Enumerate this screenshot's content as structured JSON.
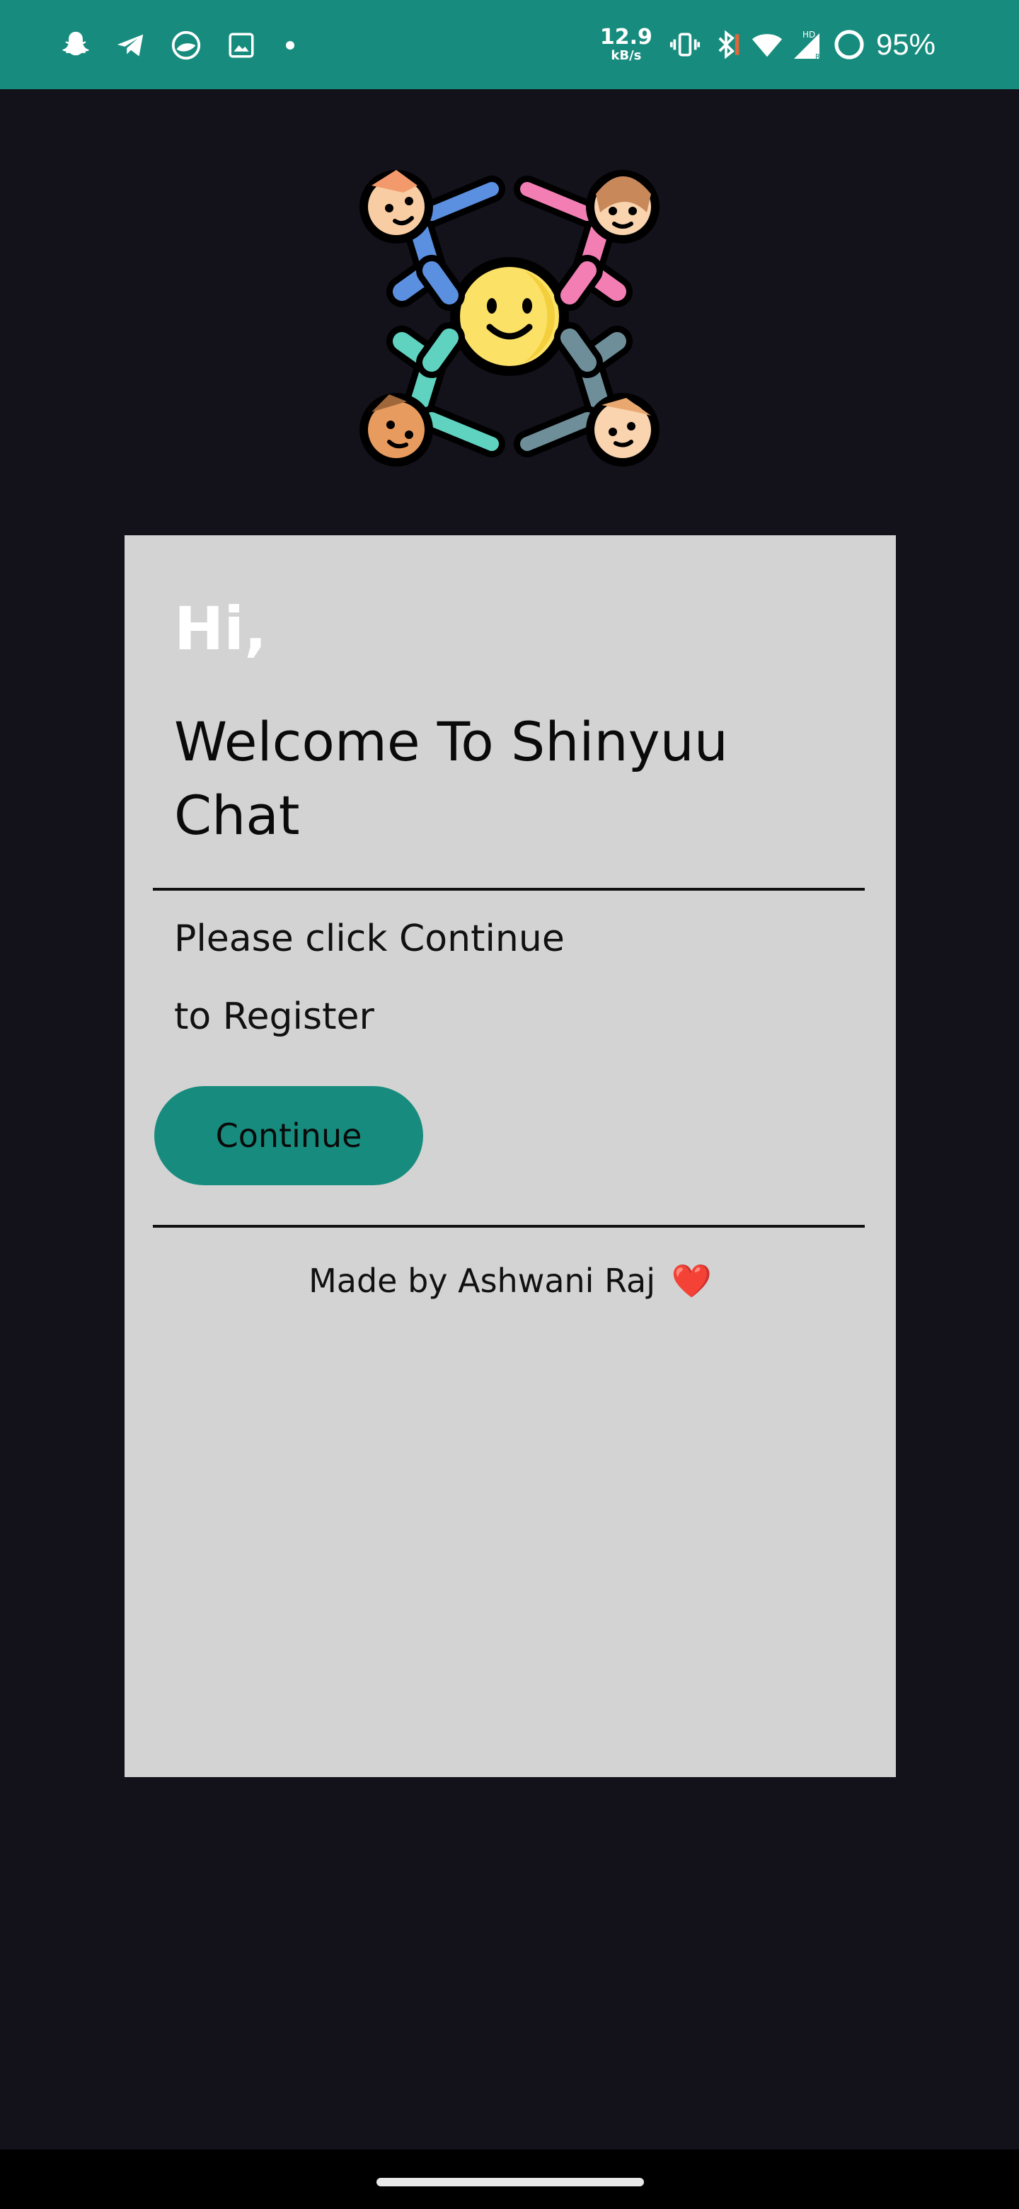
{
  "status_bar": {
    "left_icons": [
      "snapchat-icon",
      "telegram-icon",
      "reddit-icon",
      "gallery-icon",
      "notification-dot-icon"
    ],
    "net_speed_value": "12.9",
    "net_speed_unit": "kB/s",
    "right_icons": [
      "vibrate-icon",
      "bluetooth-icon",
      "wifi-icon",
      "signal-hd-icon",
      "battery-ring-icon"
    ],
    "battery": "95%",
    "background_color": "#178c7e"
  },
  "logo": {
    "icon": "friends-circle-logo-icon"
  },
  "card": {
    "greeting": "Hi,",
    "welcome": "Welcome To Shinyuu Chat",
    "instruction_line1": "Please click Continue",
    "instruction_line2": "to Register",
    "continue_label": "Continue",
    "credit": "Made by Ashwani Raj",
    "credit_emoji": "❤️",
    "background_color": "#d3d3d3",
    "accent_color": "#178c7e"
  },
  "page": {
    "background_color": "#13111a"
  }
}
